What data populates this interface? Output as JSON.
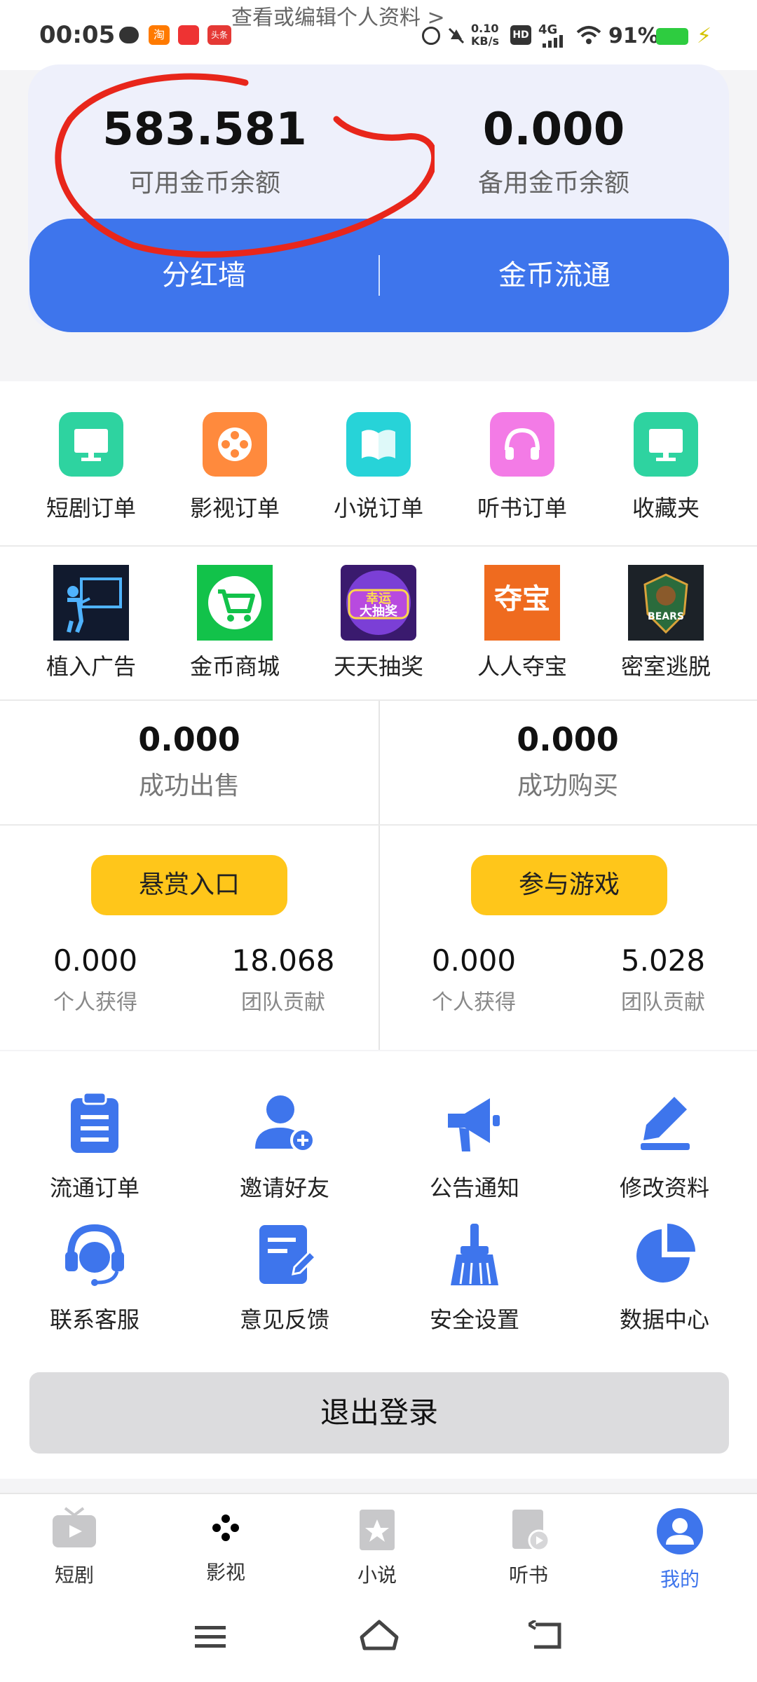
{
  "status_bar": {
    "time": "00:05",
    "network_speed": "0.10 KB/s",
    "hd": "HD",
    "signal": "4G",
    "battery": "91%",
    "app_badge_1": "淘",
    "app_badge_2": "头条"
  },
  "header": {
    "profile_link": "查看或编辑个人资料 >"
  },
  "balance": {
    "available_value": "583.581",
    "available_label": "可用金币余额",
    "reserve_value": "0.000",
    "reserve_label": "备用金币余额",
    "btn_dividend": "分红墙",
    "btn_circulate": "金币流通"
  },
  "orders": [
    {
      "label": "短剧订单",
      "icon": "monitor-icon",
      "color": "#2ed3a0"
    },
    {
      "label": "影视订单",
      "icon": "film-reel-icon",
      "color": "#ff8a3d"
    },
    {
      "label": "小说订单",
      "icon": "book-icon",
      "color": "#27d3d8"
    },
    {
      "label": "听书订单",
      "icon": "headphones-icon",
      "color": "#f37be6"
    },
    {
      "label": "收藏夹",
      "icon": "monitor-icon",
      "color": "#2ed3a0"
    }
  ],
  "features": [
    {
      "label": "植入广告",
      "icon": "presentation-icon"
    },
    {
      "label": "金币商城",
      "icon": "cart-icon"
    },
    {
      "label": "天天抽奖",
      "icon": "lucky-draw-icon",
      "badge_text": "幸运 大抽奖"
    },
    {
      "label": "人人夺宝",
      "icon": "treasure-icon",
      "badge_text": "夺宝"
    },
    {
      "label": "密室逃脱",
      "icon": "bears-logo-icon",
      "badge_text": "BEARS"
    }
  ],
  "trade": {
    "sell_value": "0.000",
    "sell_label": "成功出售",
    "buy_value": "0.000",
    "buy_label": "成功购买"
  },
  "reward": {
    "btn": "悬赏入口",
    "personal_value": "0.000",
    "personal_label": "个人获得",
    "team_value": "18.068",
    "team_label": "团队贡献"
  },
  "game": {
    "btn": "参与游戏",
    "personal_value": "0.000",
    "personal_label": "个人获得",
    "team_value": "5.028",
    "team_label": "团队贡献"
  },
  "tools": [
    {
      "label": "流通订单",
      "icon": "clipboard-icon"
    },
    {
      "label": "邀请好友",
      "icon": "add-user-icon"
    },
    {
      "label": "公告通知",
      "icon": "megaphone-icon"
    },
    {
      "label": "修改资料",
      "icon": "edit-pen-icon"
    },
    {
      "label": "联系客服",
      "icon": "headset-icon"
    },
    {
      "label": "意见反馈",
      "icon": "feedback-note-icon"
    },
    {
      "label": "安全设置",
      "icon": "broom-icon"
    },
    {
      "label": "数据中心",
      "icon": "pie-chart-icon"
    }
  ],
  "logout": "退出登录",
  "bottom_nav": [
    {
      "label": "短剧",
      "icon": "tv-icon",
      "active": false
    },
    {
      "label": "影视",
      "icon": "film-reel-icon",
      "active": false
    },
    {
      "label": "小说",
      "icon": "novel-icon",
      "active": false
    },
    {
      "label": "听书",
      "icon": "audiobook-icon",
      "active": false
    },
    {
      "label": "我的",
      "icon": "profile-icon",
      "active": true
    }
  ],
  "colors": {
    "brand_blue": "#3e75ec",
    "accent_yellow": "#ffc61a",
    "annotation_red": "#e8261b"
  }
}
